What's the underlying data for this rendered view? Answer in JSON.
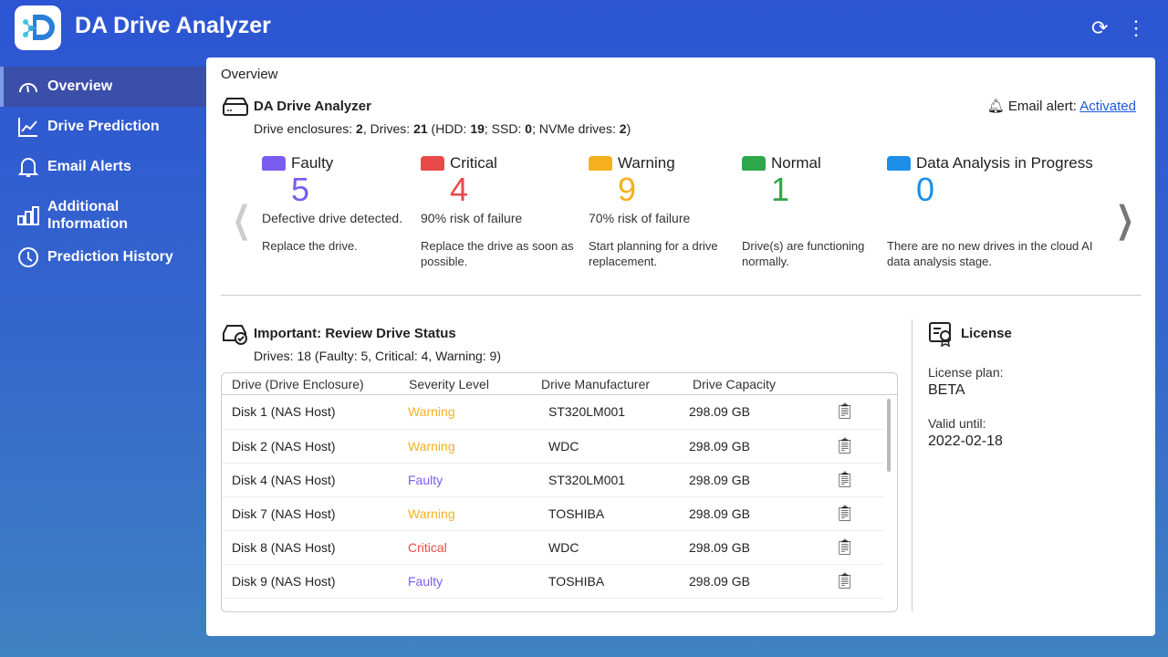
{
  "app": {
    "title": "DA Drive Analyzer"
  },
  "sidebar": {
    "items": [
      {
        "label": "Overview"
      },
      {
        "label": "Drive Prediction"
      },
      {
        "label": "Email Alerts"
      },
      {
        "label": "Additional Information"
      },
      {
        "label": "Prediction History"
      }
    ]
  },
  "breadcrumb": "Overview",
  "summary": {
    "title": "DA Drive Analyzer",
    "stats_prefix": "Drive enclosures: ",
    "enclosures": "2",
    "drives_prefix": ", Drives: ",
    "drives": "21",
    "hdd_prefix": " (HDD: ",
    "hdd": "19",
    "ssd_prefix": "; SSD: ",
    "ssd": "0",
    "nvme_prefix": "; NVMe drives: ",
    "nvme": "2",
    "suffix": ")",
    "email_label": "Email alert: ",
    "email_status": "Activated"
  },
  "status": [
    {
      "label": "Faulty",
      "count": "5",
      "desc": "Defective drive detected.",
      "advice": "Replace the drive.",
      "color": "#7b5cf0"
    },
    {
      "label": "Critical",
      "count": "4",
      "desc": "90% risk of failure",
      "advice": "Replace the drive as soon as possible.",
      "color": "#e84a4a"
    },
    {
      "label": "Warning",
      "count": "9",
      "desc": "70% risk of failure",
      "advice": "Start planning for a drive replacement.",
      "color": "#f5b020"
    },
    {
      "label": "Normal",
      "count": "1",
      "desc": "",
      "advice": "Drive(s) are functioning normally.",
      "color": "#2ea84a"
    },
    {
      "label": "Data Analysis in Progress",
      "count": "0",
      "desc": "",
      "advice": "There are no new drives in the cloud AI data analysis stage.",
      "color": "#1e8fe8"
    }
  ],
  "review": {
    "title": "Important: Review Drive Status",
    "summary": "Drives: 18 (Faulty: 5, Critical: 4, Warning: 9)",
    "columns": [
      "Drive (Drive Enclosure)",
      "Severity Level",
      "Drive Manufacturer",
      "Drive Capacity"
    ],
    "rows": [
      [
        "Disk 1 (NAS Host)",
        "Warning",
        "ST320LM001",
        "298.09 GB"
      ],
      [
        "Disk 2 (NAS Host)",
        "Warning",
        "WDC",
        "298.09 GB"
      ],
      [
        "Disk 4 (NAS Host)",
        "Faulty",
        "ST320LM001",
        "298.09 GB"
      ],
      [
        "Disk 7 (NAS Host)",
        "Warning",
        "TOSHIBA",
        "298.09 GB"
      ],
      [
        "Disk 8 (NAS Host)",
        "Critical",
        "WDC",
        "298.09 GB"
      ],
      [
        "Disk 9 (NAS Host)",
        "Faulty",
        "TOSHIBA",
        "298.09 GB"
      ]
    ]
  },
  "license": {
    "title": "License",
    "plan_label": "License plan:",
    "plan": "BETA",
    "valid_label": "Valid until:",
    "valid": "2022-02-18"
  },
  "severity_colors": {
    "Warning": "#f5b020",
    "Faulty": "#7b5cf0",
    "Critical": "#e84a4a"
  }
}
